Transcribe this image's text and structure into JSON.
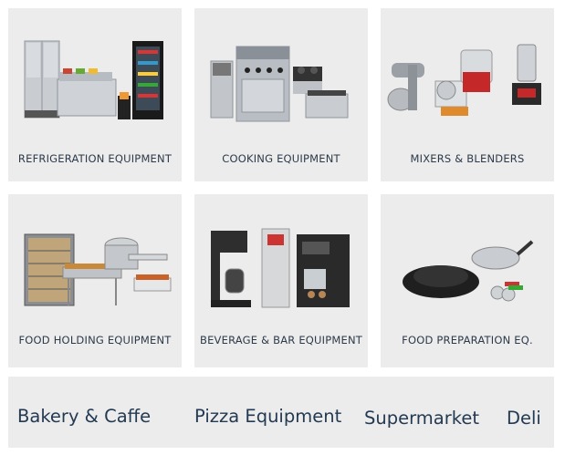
{
  "categories": [
    {
      "label": "REFRIGERATION EQUIPMENT",
      "icon": "refrigeration-icon"
    },
    {
      "label": "COOKING  EQUIPMENT",
      "icon": "cooking-icon"
    },
    {
      "label": "MIXERS & BLENDERS",
      "icon": "mixer-icon"
    },
    {
      "label": "FOOD HOLDING EQUIPMENT",
      "icon": "food-holding-icon"
    },
    {
      "label": "BEVERAGE & BAR EQUIPMENT",
      "icon": "beverage-icon"
    },
    {
      "label": "FOOD PREPARATION EQ.",
      "icon": "food-prep-icon"
    }
  ],
  "bottom_links": [
    {
      "label": "Bakery & Caffe"
    },
    {
      "label": "Pizza Equipment"
    },
    {
      "label": "Supermarket"
    },
    {
      "label": "Deli"
    }
  ],
  "colors": {
    "card_bg": "#ececec",
    "label_text": "#2d3a4a",
    "link_text": "#243a52"
  }
}
